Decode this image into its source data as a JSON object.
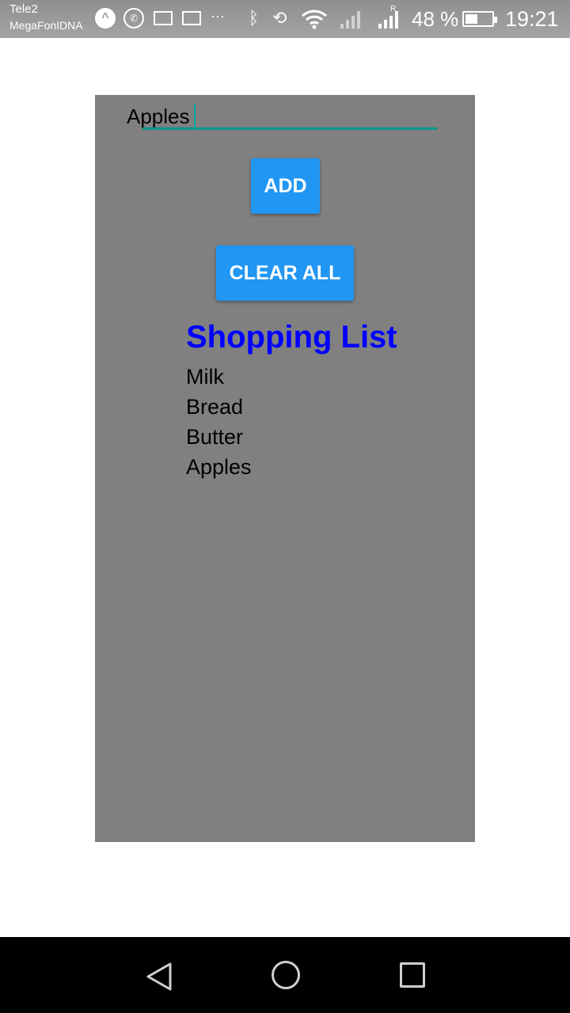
{
  "status_bar": {
    "carrier_primary": "Tele2",
    "carrier_secondary": "MegaFonIDNA",
    "roaming_mark": "R",
    "battery_percent_text": "48 %",
    "battery_level": 0.48,
    "time": "19:21",
    "icons": [
      "notification-app-icon",
      "whatsapp-icon",
      "mail-icon",
      "keyboard-icon",
      "more-icon",
      "bluetooth-icon",
      "rotation-icon",
      "wifi-icon",
      "signal-icon",
      "signal-icon",
      "battery-icon"
    ]
  },
  "app": {
    "background_color": "#808080",
    "input": {
      "value": "Apples",
      "underline_color": "#00968c"
    },
    "add_button_label": "ADD",
    "clear_button_label": "CLEAR ALL",
    "button_color": "#2196f3",
    "list_title": "Shopping List",
    "list_title_color": "#0000ff",
    "items": [
      "Milk",
      "Bread",
      "Butter",
      "Apples"
    ]
  },
  "nav_bar": {
    "icons": [
      "back-icon",
      "home-icon",
      "recents-icon"
    ]
  }
}
